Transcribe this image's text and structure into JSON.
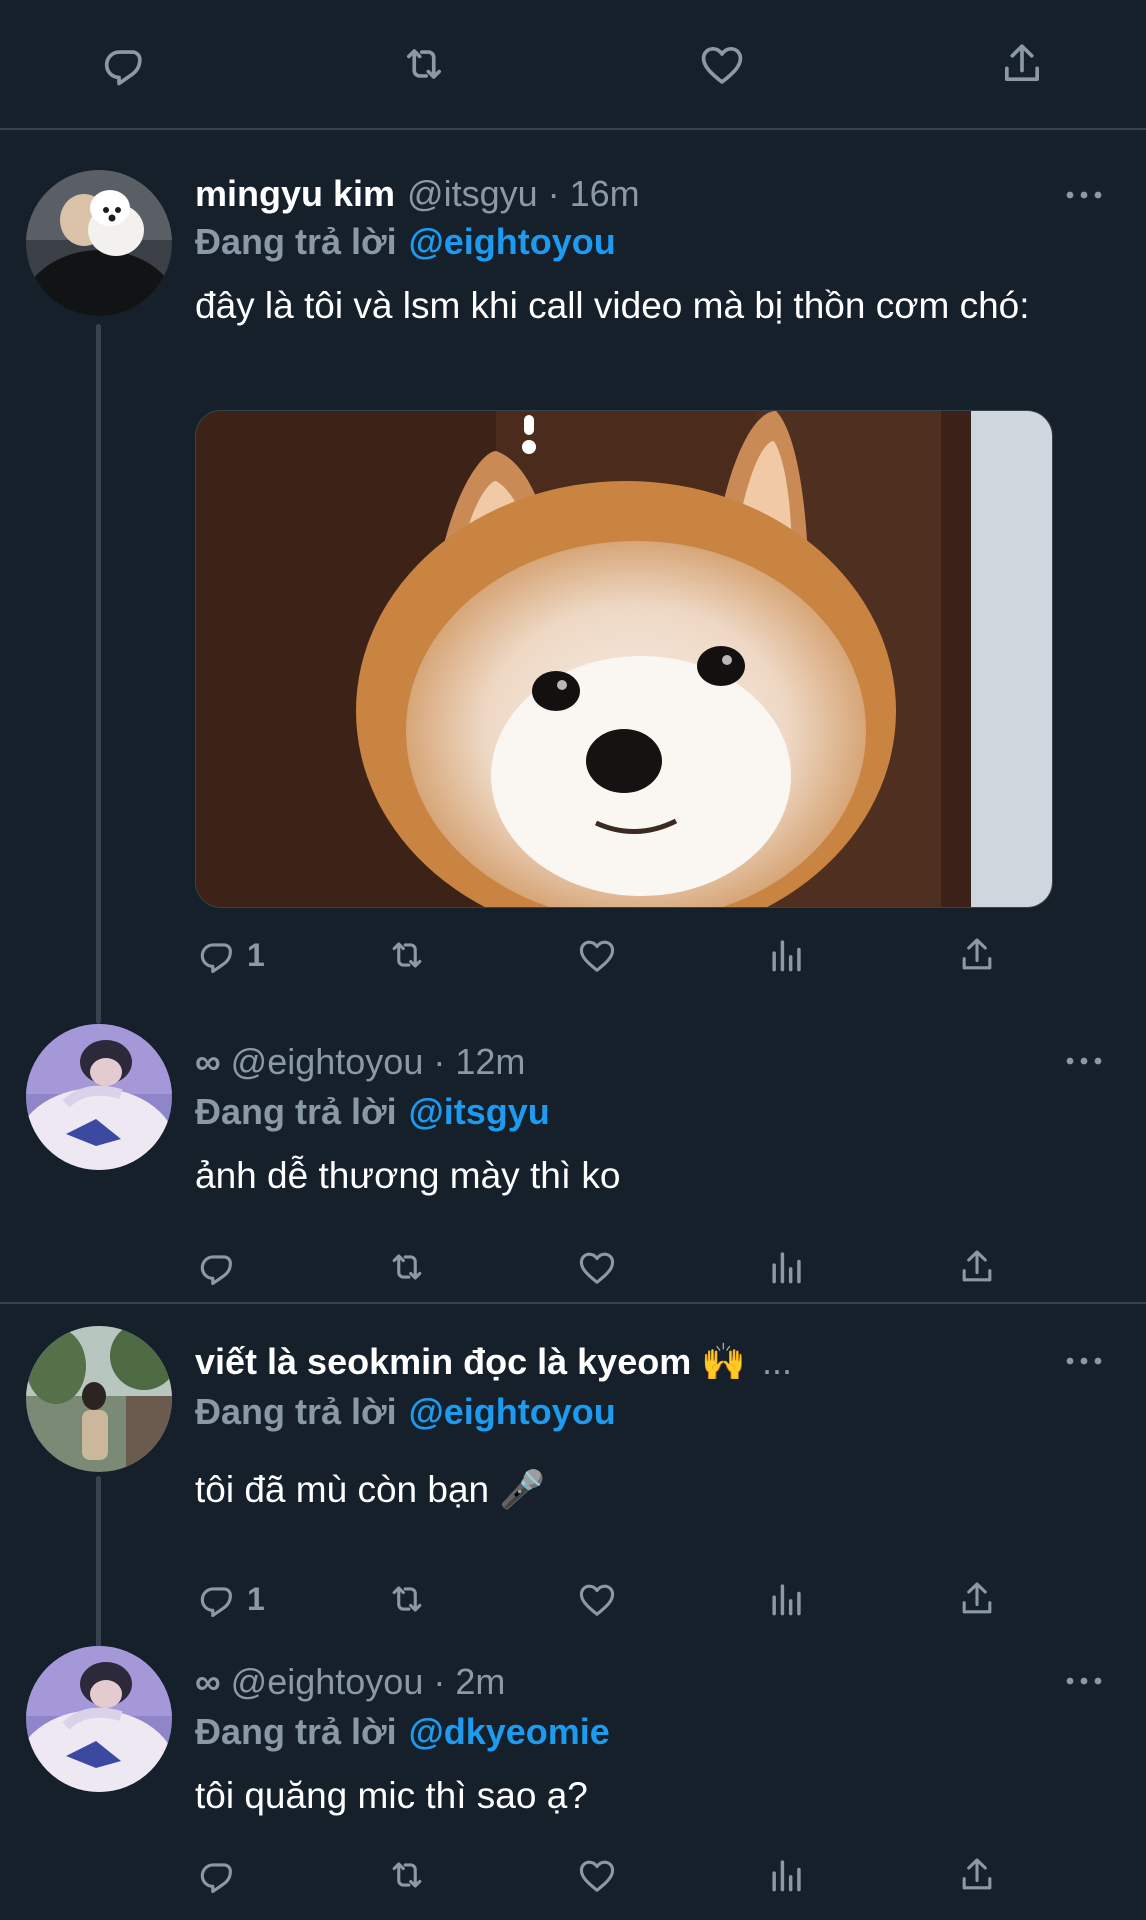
{
  "colors": {
    "background": "#15202b",
    "accent": "#1d9bf0",
    "muted": "#8b98a5",
    "border": "#38444d"
  },
  "top_actions": [
    "reply-icon",
    "retweet-icon",
    "like-icon",
    "share-icon"
  ],
  "tweets": [
    {
      "name": "mingyu kim",
      "handle": "@itsgyu",
      "time": "· 16m",
      "reply_prefix": "Đang trả lời",
      "reply_mention": "@eightoyou",
      "text": "đây là tôi và lsm khi call video mà bị thồn cơm chó:",
      "reply_count": "1"
    },
    {
      "name_icon": "∞",
      "handle": "@eightoyou",
      "time": "· 12m",
      "reply_prefix": "Đang trả lời",
      "reply_mention": "@itsgyu",
      "text": "ảnh dễ thương mày thì ko"
    },
    {
      "name": "viết là seokmin đọc là kyeom 🙌",
      "name_overflow": "...",
      "reply_prefix": "Đang trả lời",
      "reply_mention": "@eightoyou",
      "text": "tôi đã mù còn bạn 🎤",
      "reply_count": "1"
    },
    {
      "name_icon": "∞",
      "handle": "@eightoyou",
      "time": "· 2m",
      "reply_prefix": "Đang trả lời",
      "reply_mention": "@dkyeomie",
      "text": "tôi quăng mic thì sao ạ?"
    }
  ]
}
